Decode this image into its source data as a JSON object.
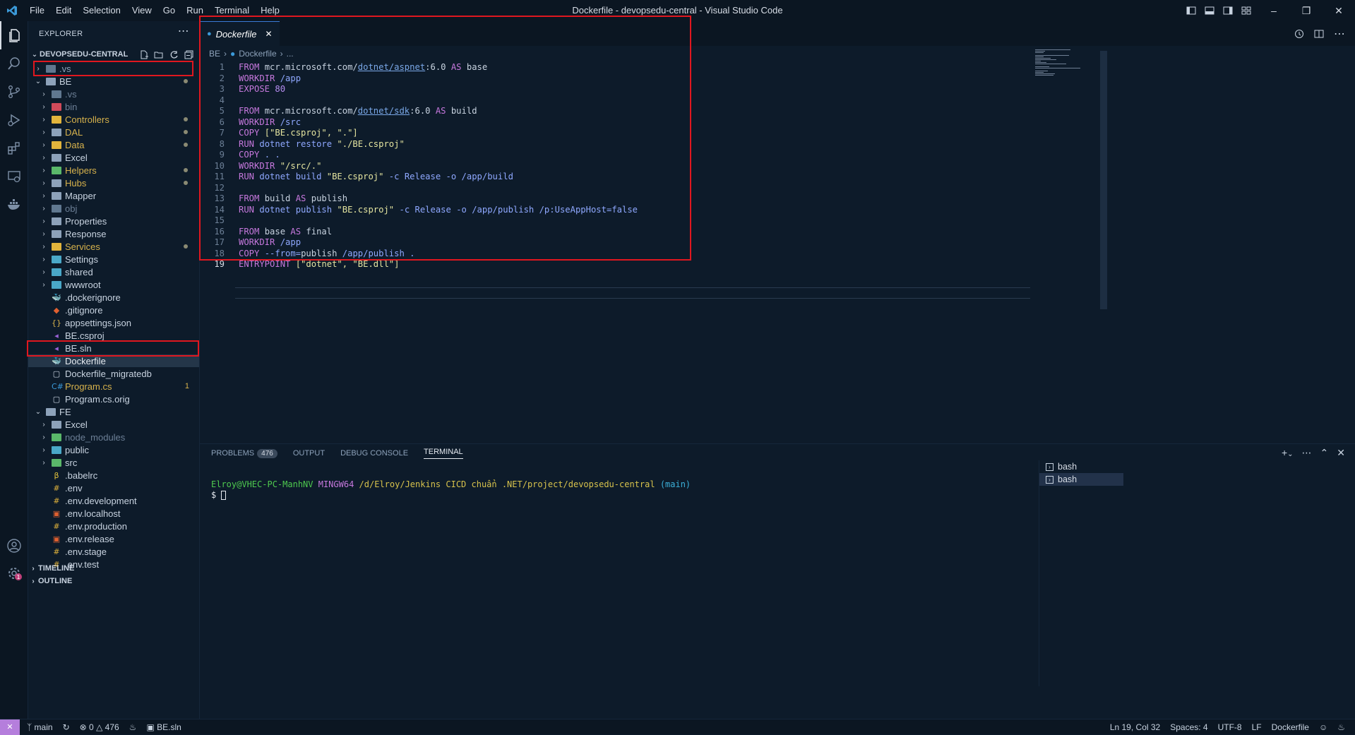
{
  "window": {
    "title": "Dockerfile - devopsedu-central - Visual Studio Code"
  },
  "menu": [
    "File",
    "Edit",
    "Selection",
    "View",
    "Go",
    "Run",
    "Terminal",
    "Help"
  ],
  "explorer": {
    "header": "EXPLORER",
    "root": "DEVOPSEDU-CENTRAL",
    "items": [
      {
        "label": ".vs",
        "kind": "folder",
        "depth": 1,
        "color": "#8da2ba",
        "icon_color": "#607890",
        "chev": "›"
      },
      {
        "label": "BE",
        "kind": "folder-open",
        "depth": 1,
        "color": "#c8d3e0",
        "icon_color": "#8da2ba",
        "chev": "⌄",
        "dot": true
      },
      {
        "label": ".vs",
        "kind": "folder",
        "depth": 2,
        "color": "#6c7f96",
        "icon_color": "#607890",
        "chev": "›"
      },
      {
        "label": "bin",
        "kind": "folder",
        "depth": 2,
        "color": "#6c7f96",
        "icon_color": "#d04a5a",
        "chev": "›"
      },
      {
        "label": "Controllers",
        "kind": "folder",
        "depth": 2,
        "color": "#d7b24c",
        "icon_color": "#e2b43c",
        "chev": "›",
        "dot": true
      },
      {
        "label": "DAL",
        "kind": "folder",
        "depth": 2,
        "color": "#d7b24c",
        "icon_color": "#8da2ba",
        "chev": "›",
        "dot": true
      },
      {
        "label": "Data",
        "kind": "folder",
        "depth": 2,
        "color": "#d7b24c",
        "icon_color": "#e2b43c",
        "chev": "›",
        "dot": true
      },
      {
        "label": "Excel",
        "kind": "folder",
        "depth": 2,
        "color": "#c8d3e0",
        "icon_color": "#8da2ba",
        "chev": "›"
      },
      {
        "label": "Helpers",
        "kind": "folder",
        "depth": 2,
        "color": "#d7b24c",
        "icon_color": "#5ab86a",
        "chev": "›",
        "dot": true
      },
      {
        "label": "Hubs",
        "kind": "folder",
        "depth": 2,
        "color": "#d7b24c",
        "icon_color": "#8da2ba",
        "chev": "›",
        "dot": true
      },
      {
        "label": "Mapper",
        "kind": "folder",
        "depth": 2,
        "color": "#c8d3e0",
        "icon_color": "#8da2ba",
        "chev": "›"
      },
      {
        "label": "obj",
        "kind": "folder",
        "depth": 2,
        "color": "#6c7f96",
        "icon_color": "#607890",
        "chev": "›"
      },
      {
        "label": "Properties",
        "kind": "folder",
        "depth": 2,
        "color": "#c8d3e0",
        "icon_color": "#8da2ba",
        "chev": "›"
      },
      {
        "label": "Response",
        "kind": "folder",
        "depth": 2,
        "color": "#c8d3e0",
        "icon_color": "#8da2ba",
        "chev": "›"
      },
      {
        "label": "Services",
        "kind": "folder",
        "depth": 2,
        "color": "#d7b24c",
        "icon_color": "#e2b43c",
        "chev": "›",
        "dot": true
      },
      {
        "label": "Settings",
        "kind": "folder",
        "depth": 2,
        "color": "#c8d3e0",
        "icon_color": "#4aa8c8",
        "chev": "›"
      },
      {
        "label": "shared",
        "kind": "folder",
        "depth": 2,
        "color": "#c8d3e0",
        "icon_color": "#4aa8c8",
        "chev": "›"
      },
      {
        "label": "wwwroot",
        "kind": "folder",
        "depth": 2,
        "color": "#c8d3e0",
        "icon_color": "#4aa8c8",
        "chev": "›"
      },
      {
        "label": ".dockerignore",
        "kind": "file",
        "depth": 2,
        "color": "#c8d3e0",
        "glyph": "🐳",
        "icon_color": "#3b9ad9"
      },
      {
        "label": ".gitignore",
        "kind": "file",
        "depth": 2,
        "color": "#c8d3e0",
        "glyph": "◆",
        "icon_color": "#e06030"
      },
      {
        "label": "appsettings.json",
        "kind": "file",
        "depth": 2,
        "color": "#c8d3e0",
        "glyph": "{}",
        "icon_color": "#d7b24c"
      },
      {
        "label": "BE.csproj",
        "kind": "file",
        "depth": 2,
        "color": "#c8d3e0",
        "glyph": "◂",
        "icon_color": "#9a62d8"
      },
      {
        "label": "BE.sln",
        "kind": "file",
        "depth": 2,
        "color": "#c8d3e0",
        "glyph": "◂",
        "icon_color": "#9a62d8"
      },
      {
        "label": "Dockerfile",
        "kind": "file",
        "depth": 2,
        "color": "#e6ebf1",
        "glyph": "🐳",
        "icon_color": "#3b9ad9",
        "selected": true
      },
      {
        "label": "Dockerfile_migratedb",
        "kind": "file",
        "depth": 2,
        "color": "#c8d3e0",
        "glyph": "▢",
        "icon_color": "#c8d3e0"
      },
      {
        "label": "Program.cs",
        "kind": "file",
        "depth": 2,
        "color": "#d7b24c",
        "glyph": "C#",
        "icon_color": "#3b9ad9",
        "badge": "1"
      },
      {
        "label": "Program.cs.orig",
        "kind": "file",
        "depth": 2,
        "color": "#c8d3e0",
        "glyph": "▢",
        "icon_color": "#c8d3e0"
      },
      {
        "label": "FE",
        "kind": "folder-open",
        "depth": 1,
        "color": "#c8d3e0",
        "icon_color": "#8da2ba",
        "chev": "⌄"
      },
      {
        "label": "Excel",
        "kind": "folder",
        "depth": 2,
        "color": "#c8d3e0",
        "icon_color": "#8da2ba",
        "chev": "›"
      },
      {
        "label": "node_modules",
        "kind": "folder",
        "depth": 2,
        "color": "#6c7f96",
        "icon_color": "#5ab86a",
        "chev": "›"
      },
      {
        "label": "public",
        "kind": "folder",
        "depth": 2,
        "color": "#c8d3e0",
        "icon_color": "#4aa8c8",
        "chev": "›"
      },
      {
        "label": "src",
        "kind": "folder",
        "depth": 2,
        "color": "#c8d3e0",
        "icon_color": "#5ab86a",
        "chev": "›"
      },
      {
        "label": ".babelrc",
        "kind": "file",
        "depth": 2,
        "color": "#c8d3e0",
        "glyph": "β",
        "icon_color": "#e2c23c"
      },
      {
        "label": ".env",
        "kind": "file",
        "depth": 2,
        "color": "#c8d3e0",
        "glyph": "#",
        "icon_color": "#e2b43c"
      },
      {
        "label": ".env.development",
        "kind": "file",
        "depth": 2,
        "color": "#c8d3e0",
        "glyph": "#",
        "icon_color": "#e2b43c"
      },
      {
        "label": ".env.localhost",
        "kind": "file",
        "depth": 2,
        "color": "#c8d3e0",
        "glyph": "▣",
        "icon_color": "#e06030"
      },
      {
        "label": ".env.production",
        "kind": "file",
        "depth": 2,
        "color": "#c8d3e0",
        "glyph": "#",
        "icon_color": "#e2b43c"
      },
      {
        "label": ".env.release",
        "kind": "file",
        "depth": 2,
        "color": "#c8d3e0",
        "glyph": "▣",
        "icon_color": "#e06030"
      },
      {
        "label": ".env.stage",
        "kind": "file",
        "depth": 2,
        "color": "#c8d3e0",
        "glyph": "#",
        "icon_color": "#e2b43c"
      },
      {
        "label": ".env.test",
        "kind": "file",
        "depth": 2,
        "color": "#c8d3e0",
        "glyph": "#",
        "icon_color": "#e2b43c"
      }
    ],
    "sections": [
      "TIMELINE",
      "OUTLINE"
    ]
  },
  "editor": {
    "tab": "Dockerfile",
    "breadcrumb": [
      "BE",
      "Dockerfile",
      "..."
    ],
    "current_line": 19,
    "lines": [
      [
        {
          "t": "FROM ",
          "c": "kw"
        },
        {
          "t": "mcr.microsoft.com/",
          "c": "dflt"
        },
        {
          "t": "dotnet/aspnet",
          "c": "url"
        },
        {
          "t": ":6.0 ",
          "c": "dflt"
        },
        {
          "t": "AS ",
          "c": "kw"
        },
        {
          "t": "base",
          "c": "dflt"
        }
      ],
      [
        {
          "t": "WORKDIR ",
          "c": "kw"
        },
        {
          "t": "/app",
          "c": "arg"
        }
      ],
      [
        {
          "t": "EXPOSE ",
          "c": "kw"
        },
        {
          "t": "80",
          "c": "num"
        }
      ],
      [],
      [
        {
          "t": "FROM ",
          "c": "kw"
        },
        {
          "t": "mcr.microsoft.com/",
          "c": "dflt"
        },
        {
          "t": "dotnet/sdk",
          "c": "url"
        },
        {
          "t": ":6.0 ",
          "c": "dflt"
        },
        {
          "t": "AS ",
          "c": "kw"
        },
        {
          "t": "build",
          "c": "dflt"
        }
      ],
      [
        {
          "t": "WORKDIR ",
          "c": "kw"
        },
        {
          "t": "/src",
          "c": "arg"
        }
      ],
      [
        {
          "t": "COPY ",
          "c": "kw"
        },
        {
          "t": "[\"BE.csproj\", \".\"]",
          "c": "str"
        }
      ],
      [
        {
          "t": "RUN ",
          "c": "kw"
        },
        {
          "t": "dotnet restore ",
          "c": "arg"
        },
        {
          "t": "\"./BE.csproj\"",
          "c": "str"
        }
      ],
      [
        {
          "t": "COPY ",
          "c": "kw"
        },
        {
          "t": ". .",
          "c": "arg"
        }
      ],
      [
        {
          "t": "WORKDIR ",
          "c": "kw"
        },
        {
          "t": "\"/src/.\"",
          "c": "str"
        }
      ],
      [
        {
          "t": "RUN ",
          "c": "kw"
        },
        {
          "t": "dotnet build ",
          "c": "arg"
        },
        {
          "t": "\"BE.csproj\"",
          "c": "str"
        },
        {
          "t": " -c Release -o /app/build",
          "c": "arg"
        }
      ],
      [],
      [
        {
          "t": "FROM ",
          "c": "kw"
        },
        {
          "t": "build ",
          "c": "dflt"
        },
        {
          "t": "AS ",
          "c": "kw"
        },
        {
          "t": "publish",
          "c": "dflt"
        }
      ],
      [
        {
          "t": "RUN ",
          "c": "kw"
        },
        {
          "t": "dotnet publish ",
          "c": "arg"
        },
        {
          "t": "\"BE.csproj\"",
          "c": "str"
        },
        {
          "t": " -c Release -o /app/publish /p:UseAppHost=false",
          "c": "arg"
        }
      ],
      [],
      [
        {
          "t": "FROM ",
          "c": "kw"
        },
        {
          "t": "base ",
          "c": "dflt"
        },
        {
          "t": "AS ",
          "c": "kw"
        },
        {
          "t": "final",
          "c": "dflt"
        }
      ],
      [
        {
          "t": "WORKDIR ",
          "c": "kw"
        },
        {
          "t": "/app",
          "c": "arg"
        }
      ],
      [
        {
          "t": "COPY ",
          "c": "kw"
        },
        {
          "t": "--from=",
          "c": "arg"
        },
        {
          "t": "publish",
          "c": "dflt"
        },
        {
          "t": " /app/publish .",
          "c": "arg"
        }
      ],
      [
        {
          "t": "ENTRYPOINT ",
          "c": "kw"
        },
        {
          "t": "[\"dotnet\", \"BE.dll\"]",
          "c": "str"
        }
      ]
    ]
  },
  "panel": {
    "tabs": [
      "PROBLEMS",
      "OUTPUT",
      "DEBUG CONSOLE",
      "TERMINAL"
    ],
    "problems_count": "476",
    "terminal": {
      "user": "Elroy@VHEC-PC-ManhNV",
      "env": "MINGW64",
      "path": "/d/Elroy/Jenkins CICD chuẩn .NET/project/devopsedu-central",
      "branch": "(main)",
      "prompt": "$ "
    },
    "terminals": [
      "bash",
      "bash"
    ]
  },
  "status": {
    "branch": "main",
    "errors": "0",
    "warnings": "476",
    "solution": "BE.sln",
    "position": "Ln 19, Col 32",
    "spaces": "Spaces: 4",
    "encoding": "UTF-8",
    "eol": "LF",
    "language": "Dockerfile"
  },
  "colors": {
    "highlight_box": "#e0171f",
    "accent": "#3a7bd5"
  }
}
